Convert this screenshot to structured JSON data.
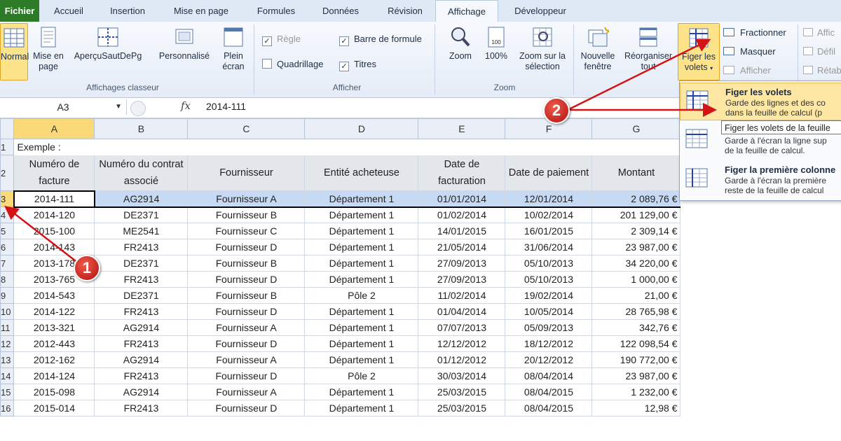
{
  "tabs": [
    {
      "label": "Fichier"
    },
    {
      "label": "Accueil"
    },
    {
      "label": "Insertion"
    },
    {
      "label": "Mise en page"
    },
    {
      "label": "Formules"
    },
    {
      "label": "Données"
    },
    {
      "label": "Révision"
    },
    {
      "label": "Affichage"
    },
    {
      "label": "Développeur"
    }
  ],
  "ribbon": {
    "views": {
      "normal": "Normal",
      "page_layout": "Mise en page",
      "page_break": "AperçuSautDePg",
      "custom": "Personnalisé",
      "full_screen": "Plein écran",
      "group_label": "Affichages classeur"
    },
    "show": {
      "ruler": "Règle",
      "formula_bar": "Barre de formule",
      "gridlines": "Quadrillage",
      "headings": "Titres",
      "group_label": "Afficher"
    },
    "zoom": {
      "zoom": "Zoom",
      "hundred": "100%",
      "hundred_icon_text": "100",
      "zoom_selection": "Zoom sur la sélection",
      "group_label": "Zoom"
    },
    "window": {
      "new_window": "Nouvelle fenêtre",
      "arrange_all": "Réorganiser tout",
      "freeze_panes": "Figer les volets",
      "split": "Fractionner",
      "hide": "Masquer",
      "unhide": "Afficher",
      "side_by_side": "Affic",
      "sync_scroll": "Défil",
      "reset_position": "Rétab"
    }
  },
  "formula_bar": {
    "cell_ref": "A3",
    "fx": "fx",
    "value": "2014-111"
  },
  "sheet": {
    "columns": [
      "A",
      "B",
      "C",
      "D",
      "E",
      "F",
      "G"
    ],
    "example_label": "Exemple :",
    "headers": [
      "Numéro de facture",
      "Numéro du contrat associé",
      "Fournisseur",
      "Entité acheteuse",
      "Date de facturation",
      "Date de paiement",
      "Montant"
    ],
    "rows": [
      [
        "2014-111",
        "AG2914",
        "Fournisseur A",
        "Département 1",
        "01/01/2014",
        "12/01/2014",
        "2 089,76 €"
      ],
      [
        "2014-120",
        "DE2371",
        "Fournisseur B",
        "Département 1",
        "01/02/2014",
        "10/02/2014",
        "201 129,00 €"
      ],
      [
        "2015-100",
        "ME2541",
        "Fournisseur C",
        "Département 1",
        "14/01/2015",
        "16/01/2015",
        "2 309,14 €"
      ],
      [
        "2014-143",
        "FR2413",
        "Fournisseur D",
        "Département 1",
        "21/05/2014",
        "31/06/2014",
        "23 987,00 €"
      ],
      [
        "2013-178",
        "DE2371",
        "Fournisseur B",
        "Département 1",
        "27/09/2013",
        "05/10/2013",
        "34 220,00 €"
      ],
      [
        "2013-765",
        "FR2413",
        "Fournisseur D",
        "Département 1",
        "27/09/2013",
        "05/10/2013",
        "1 000,00 €"
      ],
      [
        "2014-543",
        "DE2371",
        "Fournisseur B",
        "Pôle 2",
        "11/02/2014",
        "19/02/2014",
        "21,00 €"
      ],
      [
        "2014-122",
        "FR2413",
        "Fournisseur D",
        "Département 1",
        "01/04/2014",
        "10/05/2014",
        "28 765,98 €"
      ],
      [
        "2013-321",
        "AG2914",
        "Fournisseur A",
        "Département 1",
        "07/07/2013",
        "05/09/2013",
        "342,76 €"
      ],
      [
        "2012-443",
        "FR2413",
        "Fournisseur D",
        "Département 1",
        "12/12/2012",
        "18/12/2012",
        "122 098,54 €"
      ],
      [
        "2012-162",
        "AG2914",
        "Fournisseur A",
        "Département 1",
        "01/12/2012",
        "20/12/2012",
        "190 772,00 €"
      ],
      [
        "2014-124",
        "FR2413",
        "Fournisseur D",
        "Pôle 2",
        "30/03/2014",
        "08/04/2014",
        "23 987,00 €"
      ],
      [
        "2015-098",
        "AG2914",
        "Fournisseur A",
        "Département 1",
        "25/03/2015",
        "08/04/2015",
        "1 232,00 €"
      ],
      [
        "2015-014",
        "FR2413",
        "Fournisseur D",
        "Département 1",
        "25/03/2015",
        "08/04/2015",
        "12,98 €"
      ]
    ],
    "row_numbers": [
      "1",
      "2",
      "3",
      "4",
      "5",
      "6",
      "7",
      "8",
      "9",
      "10",
      "11",
      "12",
      "13",
      "14",
      "15",
      "16"
    ]
  },
  "freeze_menu": {
    "items": [
      {
        "title": "Figer les volets",
        "desc1": "Garde des lignes et des co",
        "desc2": "dans la feuille de calcul (p"
      },
      {
        "title": "",
        "desc1": "Garde à l'écran la ligne sup",
        "desc2": "de la feuille de calcul."
      },
      {
        "title": "Figer la première colonne",
        "desc1": "Garde à l'écran la première",
        "desc2": "reste de la feuille de calcul"
      }
    ],
    "tooltip": "Figer les volets de la feuille"
  },
  "annotations": {
    "badge1": "1",
    "badge2": "2"
  },
  "colors": {
    "file_tab": "#2d7a28",
    "highlight": "#fde48a",
    "badge": "#c41a1a",
    "selected_row": "#c7daf4",
    "header_fill": "#e3e6ea"
  }
}
